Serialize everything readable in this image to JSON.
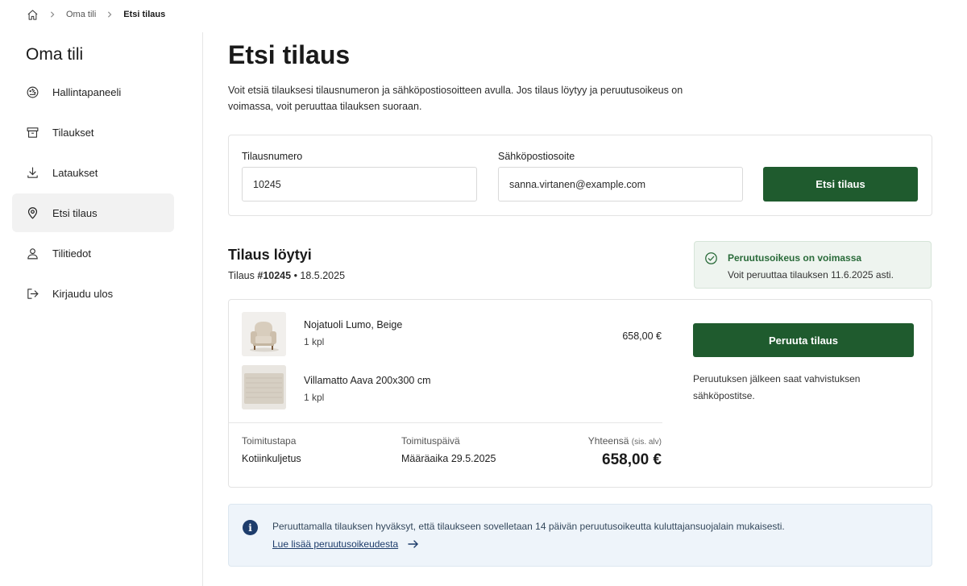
{
  "breadcrumb": {
    "home_icon": "home-icon",
    "items": [
      "Oma tili",
      "Etsi tilaus"
    ]
  },
  "sidebar": {
    "title": "Oma tili",
    "items": [
      {
        "label": "Hallintapaneeli",
        "icon": "dashboard-icon",
        "active": false
      },
      {
        "label": "Tilaukset",
        "icon": "archive-box-icon",
        "active": false
      },
      {
        "label": "Lataukset",
        "icon": "download-icon",
        "active": false
      },
      {
        "label": "Etsi tilaus",
        "icon": "map-pin-icon",
        "active": true
      },
      {
        "label": "Tilitiedot",
        "icon": "user-icon",
        "active": false
      },
      {
        "label": "Kirjaudu ulos",
        "icon": "logout-icon",
        "active": false
      }
    ]
  },
  "main": {
    "title": "Etsi tilaus",
    "intro": "Voit etsiä tilauksesi tilausnumeron ja sähköpostiosoitteen avulla. Jos tilaus löytyy ja peruutusoikeus on voimassa, voit peruuttaa tilauksen suoraan."
  },
  "search": {
    "order_label": "Tilausnumero",
    "order_value": "10245",
    "email_label": "Sähköpostiosoite",
    "email_value": "sanna.virtanen@example.com",
    "button": "Etsi tilaus"
  },
  "result": {
    "title": "Tilaus löytyi",
    "order_prefix": "Tilaus",
    "order_number": "#10245",
    "order_date": "• 18.5.2025",
    "status": {
      "title": "Peruutusoikeus on voimassa",
      "text": "Voit peruuttaa tilauksen 11.6.2025 asti.",
      "color": "#2a6b3a"
    },
    "items": [
      {
        "name": "Nojatuoli Lumo, Beige",
        "qty": "1 kpl",
        "price": "658,00 €"
      },
      {
        "name": "Villamatto Aava 200x300 cm",
        "qty": "1 kpl"
      }
    ],
    "delivery_label": "Toimitustapa",
    "delivery_value": "Kotiinkuljetus",
    "date_label": "Toimituspäivä",
    "date_value": "Määräaika 29.5.2025",
    "total_label": "Yhteensä",
    "total_note": "(sis. alv)",
    "total_value": "658,00 €",
    "cancel_button": "Peruuta tilaus",
    "cancel_note": "Peruutuksen jälkeen saat vahvistuksen sähköpostitse."
  },
  "info": {
    "icon": "info-icon",
    "text": "Peruuttamalla tilauksen hyväksyt, että tilaukseen sovelletaan 14 päivän peruutusoikeutta kuluttajansuojalain mukaisesti.",
    "link": "Lue lisää peruutusoikeudesta"
  },
  "colors": {
    "accent": "#1f5b2e",
    "status_bg": "#eef4ef",
    "info_bg": "#eef4fa",
    "info_icon": "#1d3c6b"
  }
}
